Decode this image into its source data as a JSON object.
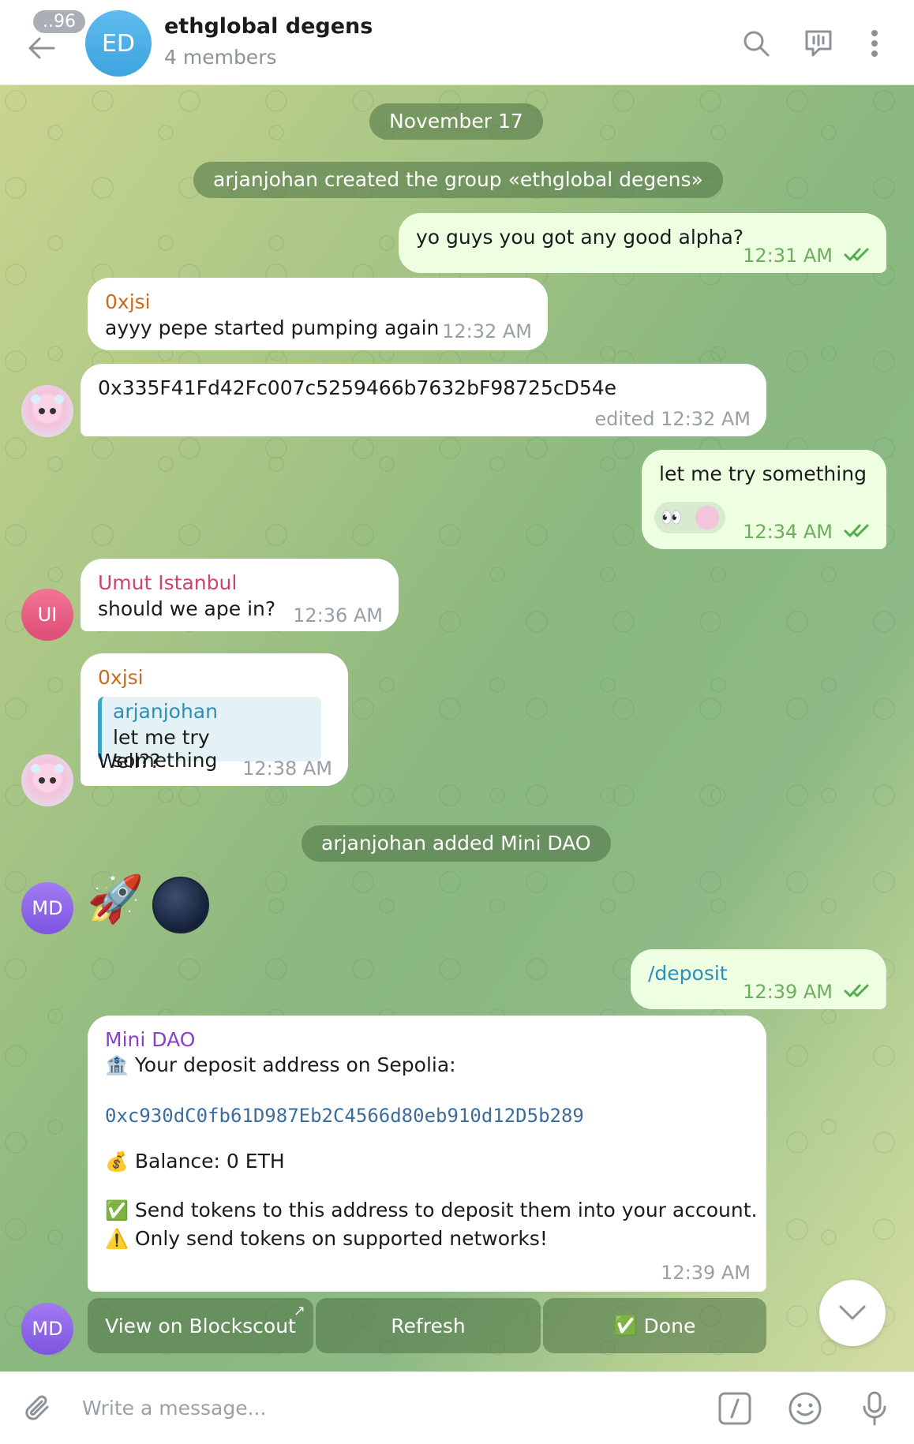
{
  "header": {
    "unread_count": "..96",
    "avatar_initials": "ED",
    "title": "ethglobal degens",
    "subtitle": "4 members"
  },
  "messages": {
    "date_pill": "November 17",
    "service_created": "arjanjohan created the group «ethglobal degens»",
    "m1": {
      "text": "yo guys you got any good alpha?",
      "time": "12:31 AM"
    },
    "m2": {
      "sender": "0xjsi",
      "text": "ayyy pepe started pumping again",
      "time": "12:32 AM"
    },
    "m3": {
      "text": "0x335F41Fd42Fc007c5259466b7632bF98725cD54e",
      "time": "edited 12:32 AM"
    },
    "m4": {
      "text": "let me try something",
      "time": "12:34 AM"
    },
    "m5": {
      "sender": "Umut Istanbul",
      "avatar": "UI",
      "text": "should we ape in?",
      "time": "12:36 AM"
    },
    "m6": {
      "sender": "0xjsi",
      "reply_name": "arjanjohan",
      "reply_text": "let me try something",
      "text": "Well??",
      "time": "12:38 AM"
    },
    "service_added": "arjanjohan added Mini DAO",
    "md_avatar": "MD",
    "m7": {
      "text": "/deposit",
      "time": "12:39 AM"
    },
    "m8": {
      "sender": "Mini DAO",
      "line1": "Your deposit address on Sepolia:",
      "address": "0xc930dC0fb61D987Eb2C4566d80eb910d12D5b289",
      "balance": "Balance: 0 ETH",
      "note1": "Send tokens to this address to deposit them into your account.",
      "note2": "Only send tokens on supported networks!",
      "time": "12:39 AM"
    }
  },
  "keyboard": {
    "btn1": "View on Blockscout",
    "btn2": "Refresh",
    "btn3": "Done"
  },
  "composer": {
    "placeholder": "Write a message..."
  },
  "colors": {
    "accent": "#3ea3de",
    "sender_0xjsi": "#cc6a1b",
    "sender_umut": "#d3416e",
    "sender_minidao": "#8a3fcf",
    "outgoing_bubble": "#eefee1",
    "read_ticks": "#4fae4e"
  }
}
